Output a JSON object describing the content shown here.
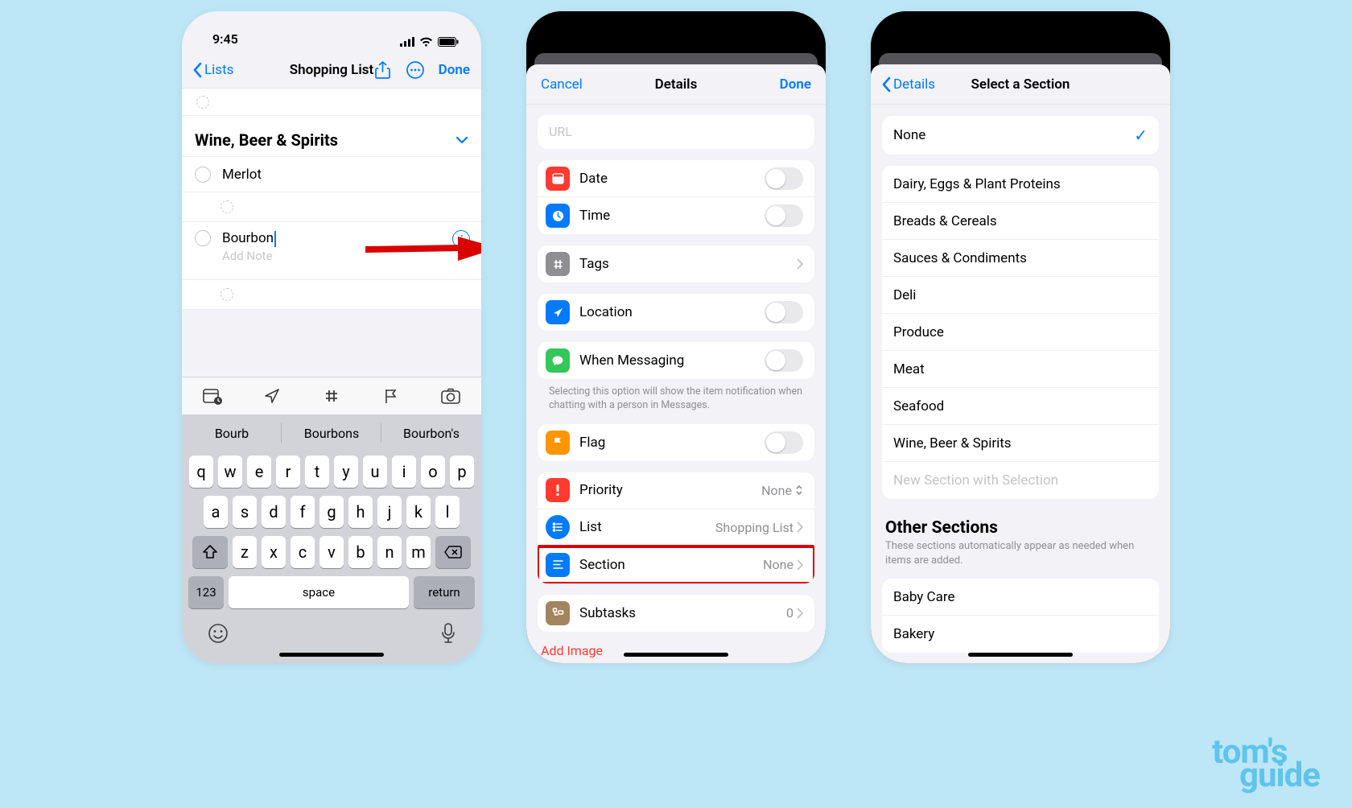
{
  "status": {
    "time": "9:45"
  },
  "phone1": {
    "nav": {
      "back": "Lists",
      "title": "Shopping List",
      "done": "Done"
    },
    "section_title": "Wine, Beer & Spirits",
    "item_merlot": "Merlot",
    "editing_item": "Bourbon",
    "add_note_placeholder": "Add Note",
    "suggestions": [
      "Bourb",
      "Bourbons",
      "Bourbon's"
    ],
    "keyboard": {
      "row1": [
        "q",
        "w",
        "e",
        "r",
        "t",
        "y",
        "u",
        "i",
        "o",
        "p"
      ],
      "row2": [
        "a",
        "s",
        "d",
        "f",
        "g",
        "h",
        "j",
        "k",
        "l"
      ],
      "row3": [
        "z",
        "x",
        "c",
        "v",
        "b",
        "n",
        "m"
      ],
      "num": "123",
      "space": "space",
      "return": "return"
    }
  },
  "phone2": {
    "nav": {
      "cancel": "Cancel",
      "title": "Details",
      "done": "Done"
    },
    "url_placeholder": "URL",
    "cells": {
      "date": "Date",
      "time": "Time",
      "tags": "Tags",
      "location": "Location",
      "messaging": "When Messaging",
      "messaging_hint": "Selecting this option will show the item notification when chatting with a person in Messages.",
      "flag": "Flag",
      "priority": "Priority",
      "priority_value": "None",
      "list": "List",
      "list_value": "Shopping List",
      "section": "Section",
      "section_value": "None",
      "subtasks": "Subtasks",
      "subtasks_value": "0",
      "add_image": "Add Image"
    }
  },
  "phone3": {
    "nav": {
      "back": "Details",
      "title": "Select a Section"
    },
    "none_option": "None",
    "sections": [
      "Dairy, Eggs & Plant Proteins",
      "Breads & Cereals",
      "Sauces & Condiments",
      "Deli",
      "Produce",
      "Meat",
      "Seafood",
      "Wine, Beer & Spirits"
    ],
    "new_section_disabled": "New Section with Selection",
    "other_header": "Other Sections",
    "other_sub": "These sections automatically appear as needed when items are added.",
    "other_items": [
      "Baby Care",
      "Bakery"
    ]
  },
  "watermark": {
    "line1": "tom's",
    "line2": "guide"
  }
}
